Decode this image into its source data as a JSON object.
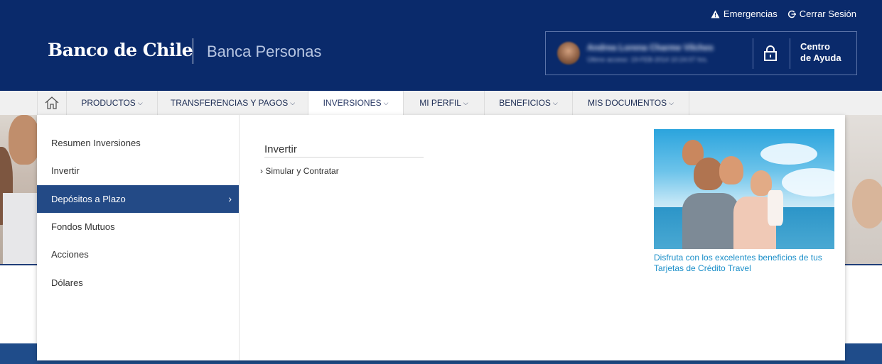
{
  "header": {
    "logo_text": "Banco de Chile",
    "section_name": "Banca Personas",
    "top_links": {
      "emergencias": "Emergencias",
      "cerrar_sesion": "Cerrar Sesión"
    },
    "user": {
      "name": "Andrea Lorena Charme Vilches",
      "last_access": "Último acceso: 19-FEB-2014 10:24:07 hrs."
    },
    "help": {
      "line1": "Centro",
      "line2": "de Ayuda"
    }
  },
  "nav": {
    "items": [
      {
        "label": "PRODUCTOS"
      },
      {
        "label": "TRANSFERENCIAS Y PAGOS"
      },
      {
        "label": "INVERSIONES"
      },
      {
        "label": "MI PERFIL"
      },
      {
        "label": "BENEFICIOS"
      },
      {
        "label": "MIS DOCUMENTOS"
      }
    ],
    "active": "INVERSIONES"
  },
  "menu": {
    "side_items": [
      {
        "label": "Resumen Inversiones"
      },
      {
        "label": "Invertir"
      },
      {
        "label": "Depósitos a Plazo"
      },
      {
        "label": "Fondos Mutuos"
      },
      {
        "label": "Acciones"
      },
      {
        "label": "Dólares"
      }
    ],
    "active_item": "Depósitos a Plazo",
    "panel_title": "Invertir",
    "panel_link": "Simular y Contratar",
    "promo_caption": "Disfruta con los excelentes beneficios de tus Tarjetas de Crédito Travel"
  },
  "colors": {
    "header_bg": "#0a2a6b",
    "active_menu_bg": "#234a86",
    "promo_link": "#1b8fc9"
  },
  "icons": [
    "warning-icon",
    "logout-icon",
    "lock-icon",
    "home-icon",
    "chevron-down-icon",
    "chevron-right-icon"
  ]
}
